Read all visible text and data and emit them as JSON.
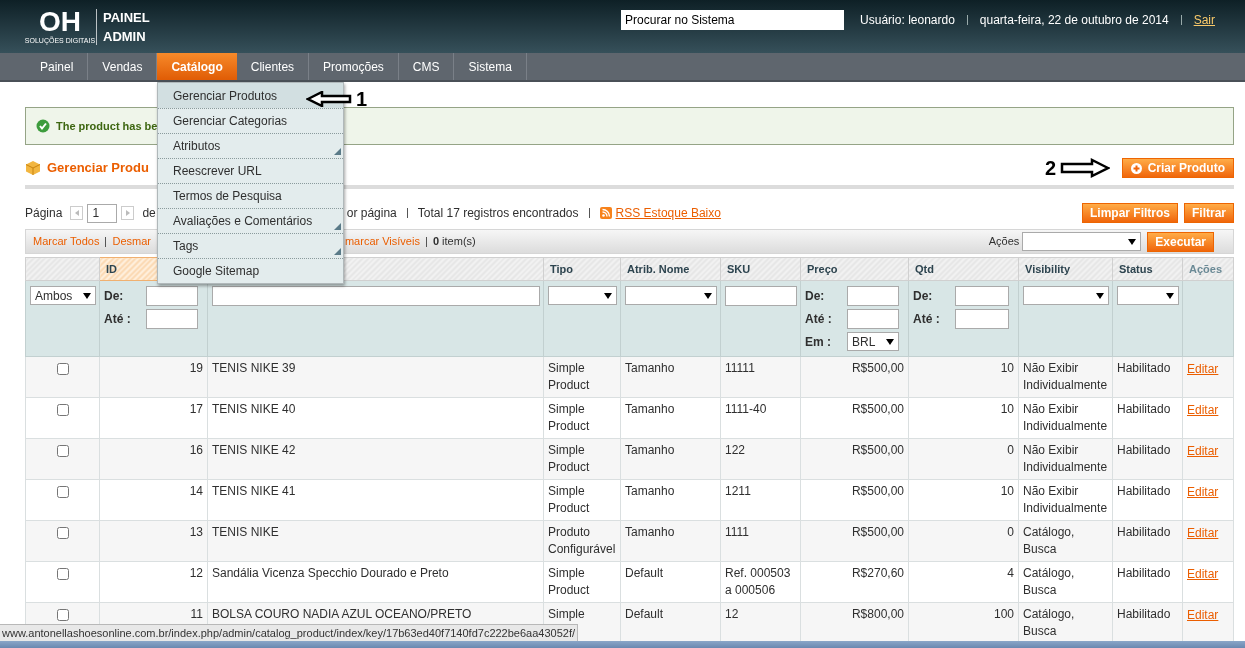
{
  "header": {
    "logo_mark": "OH",
    "logo_tagline": "SOLUÇÕES DIGITAIS",
    "logo_title": [
      "PAINEL",
      "ADMIN"
    ],
    "search": {
      "placeholder": "Procurar no Sistema"
    },
    "user": "Usuário: leonardo",
    "date": "quarta-feira, 22 de outubro de 2014",
    "logout": "Sair"
  },
  "nav": [
    {
      "label": "Painel",
      "selected": false
    },
    {
      "label": "Vendas",
      "selected": false
    },
    {
      "label": "Catálogo",
      "selected": true
    },
    {
      "label": "Clientes",
      "selected": false
    },
    {
      "label": "Promoções",
      "selected": false
    },
    {
      "label": "CMS",
      "selected": false
    },
    {
      "label": "Sistema",
      "selected": false
    }
  ],
  "menu": [
    {
      "label": "Gerenciar Produtos",
      "selected": true,
      "submenu": false
    },
    {
      "label": "Gerenciar Categorias",
      "selected": false,
      "submenu": false
    },
    {
      "label": "Atributos",
      "selected": false,
      "submenu": true
    },
    {
      "label": "Reescrever URL",
      "selected": false,
      "submenu": false
    },
    {
      "label": "Termos de Pesquisa",
      "selected": false,
      "submenu": false
    },
    {
      "label": "Avaliações e Comentários",
      "selected": false,
      "submenu": true
    },
    {
      "label": "Tags",
      "selected": false,
      "submenu": true
    },
    {
      "label": "Google Sitemap",
      "selected": false,
      "submenu": false
    }
  ],
  "annotations": [
    {
      "label": "1",
      "kind": "left"
    },
    {
      "label": "2",
      "kind": "right"
    }
  ],
  "message": "The product has be",
  "page_title": "Gerenciar Produ",
  "create_button": "Criar Produto",
  "pager": {
    "page_label": "Página",
    "page": "1",
    "of_label": "de",
    "per_page": "or página",
    "total": "Total 17 registros encontrados",
    "rss": "RSS Estoque Baixo"
  },
  "filter_buttons": [
    "Limpar Filtros",
    "Filtrar"
  ],
  "massaction": {
    "links": [
      "Marcar Todos",
      "Desmar",
      "marcar Visíveis"
    ],
    "count": "**0** item(s)",
    "actions_label": "Ações",
    "submit": "Executar"
  },
  "columns": [
    {
      "label": "ID",
      "sorted": true
    },
    {
      "label": "Tipo",
      "sorted": false
    },
    {
      "label": "Atrib. Nome",
      "sorted": false
    },
    {
      "label": "SKU",
      "sorted": false
    },
    {
      "label": "Preço",
      "sorted": false
    },
    {
      "label": "Qtd",
      "sorted": false
    },
    {
      "label": "Visibility",
      "sorted": false
    },
    {
      "label": "Status",
      "sorted": false
    },
    {
      "label": "Ações",
      "sorted": false
    }
  ],
  "filters": [
    {
      "kind": "select",
      "value": "Ambos"
    },
    {
      "kind": "range",
      "from_label": "De:",
      "to_label": "Até :"
    },
    {
      "kind": "text"
    },
    {
      "kind": "select"
    },
    {
      "kind": "select"
    },
    {
      "kind": "text"
    },
    {
      "kind": "range",
      "from_label": "De:",
      "to_label": "Até :",
      "currency_label": "Em :",
      "currency": "BRL"
    },
    {
      "kind": "range",
      "from_label": "De:",
      "to_label": "Até :"
    },
    {
      "kind": "select"
    },
    {
      "kind": "select"
    },
    {
      "kind": "none"
    }
  ],
  "rows": [
    {
      "checked": false,
      "id": "19",
      "name": "TENIS NIKE 39",
      "type": "Simple Product",
      "attr_set": "Tamanho",
      "sku": "11111",
      "price": "R$500,00",
      "qty": "10",
      "visibility": "Não Exibir Individualmente",
      "status": "Habilitado",
      "action": "Editar"
    },
    {
      "checked": false,
      "id": "17",
      "name": "TENIS NIKE 40",
      "type": "Simple Product",
      "attr_set": "Tamanho",
      "sku": "1111-40",
      "price": "R$500,00",
      "qty": "10",
      "visibility": "Não Exibir Individualmente",
      "status": "Habilitado",
      "action": "Editar"
    },
    {
      "checked": false,
      "id": "16",
      "name": "TENIS NIKE 42",
      "type": "Simple Product",
      "attr_set": "Tamanho",
      "sku": "122",
      "price": "R$500,00",
      "qty": "0",
      "visibility": "Não Exibir Individualmente",
      "status": "Habilitado",
      "action": "Editar"
    },
    {
      "checked": false,
      "id": "14",
      "name": "TENIS NIKE 41",
      "type": "Simple Product",
      "attr_set": "Tamanho",
      "sku": "1211",
      "price": "R$500,00",
      "qty": "10",
      "visibility": "Não Exibir Individualmente",
      "status": "Habilitado",
      "action": "Editar"
    },
    {
      "checked": false,
      "id": "13",
      "name": "TENIS NIKE",
      "type": "Produto Configurável",
      "attr_set": "Tamanho",
      "sku": "1111",
      "price": "R$500,00",
      "qty": "0",
      "visibility": "Catálogo, Busca",
      "status": "Habilitado",
      "action": "Editar"
    },
    {
      "checked": false,
      "id": "12",
      "name": "Sandália Vicenza Specchio Dourado e Preto",
      "type": "Simple Product",
      "attr_set": "Default",
      "sku": "Ref. 000503 a 000506",
      "price": "R$270,60",
      "qty": "4",
      "visibility": "Catálogo, Busca",
      "status": "Habilitado",
      "action": "Editar"
    },
    {
      "checked": false,
      "id": "11",
      "name": "BOLSA COURO NADIA AZUL OCEANO/PRETO",
      "type": "Simple",
      "attr_set": "Default",
      "sku": "12",
      "price": "R$800,00",
      "qty": "100",
      "visibility": "Catálogo, Busca",
      "status": "Habilitado",
      "action": "Editar"
    }
  ],
  "status_bar": "www.antonellashoesonline.com.br/index.php/admin/catalog_product/index/key/17b63ed40f7140fd7c222be6aa43052f/"
}
